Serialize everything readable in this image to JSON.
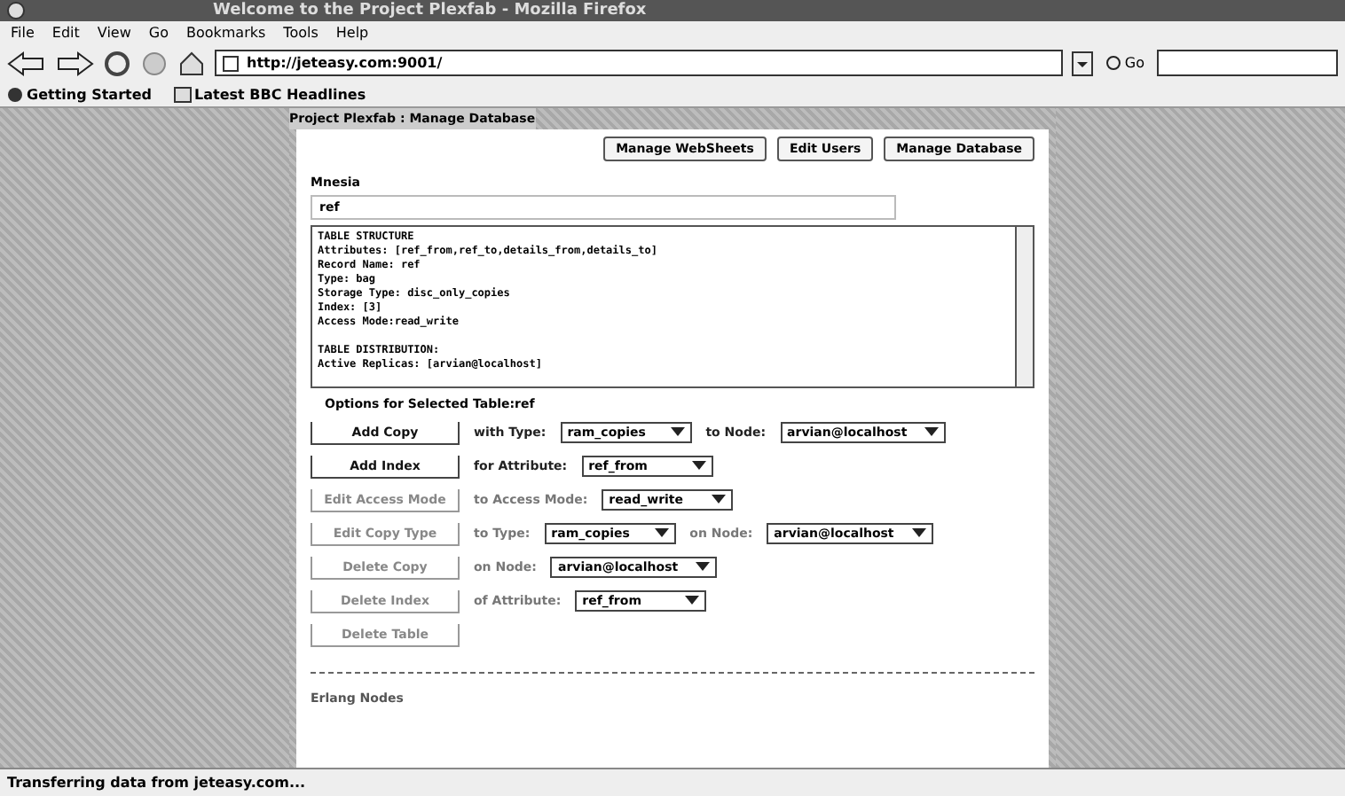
{
  "window": {
    "title": "Welcome to the Project Plexfab - Mozilla Firefox"
  },
  "menu": [
    "File",
    "Edit",
    "View",
    "Go",
    "Bookmarks",
    "Tools",
    "Help"
  ],
  "address": {
    "value": "http://jeteasy.com:9001/"
  },
  "go_label": "Go",
  "bookmarks": [
    {
      "label": "Getting Started"
    },
    {
      "label": "Latest BBC Headlines"
    }
  ],
  "breadcrumb": "Project Plexfab : Manage Database",
  "top_buttons": [
    "Manage WebSheets",
    "Edit Users",
    "Manage Database"
  ],
  "section_title": "Mnesia",
  "table_select": {
    "value": "ref"
  },
  "structure_lines": [
    "TABLE STRUCTURE",
    "Attributes: [ref_from,ref_to,details_from,details_to]",
    "Record Name: ref",
    "Type: bag",
    "Storage Type: disc_only_copies",
    "Index: [3]",
    "Access Mode:read_write"
  ],
  "distribution_lines": [
    "TABLE DISTRIBUTION:",
    "Active Replicas: [arvian@localhost]"
  ],
  "options_title": "Options for Selected Table:ref",
  "actions": [
    {
      "button": "Add Copy",
      "disabled": false,
      "parts": [
        {
          "kind": "label",
          "text": "with Type:"
        },
        {
          "kind": "select",
          "value": "ram_copies"
        },
        {
          "kind": "label",
          "text": "to Node:"
        },
        {
          "kind": "select",
          "value": "arvian@localhost"
        }
      ]
    },
    {
      "button": "Add Index",
      "disabled": false,
      "parts": [
        {
          "kind": "label",
          "text": "for Attribute:"
        },
        {
          "kind": "select",
          "value": "ref_from"
        }
      ]
    },
    {
      "button": "Edit Access Mode",
      "disabled": true,
      "parts": [
        {
          "kind": "label",
          "text": "to Access Mode:"
        },
        {
          "kind": "select",
          "value": "read_write"
        }
      ]
    },
    {
      "button": "Edit Copy Type",
      "disabled": true,
      "parts": [
        {
          "kind": "label",
          "text": "to Type:"
        },
        {
          "kind": "select",
          "value": "ram_copies"
        },
        {
          "kind": "label",
          "text": "on Node:"
        },
        {
          "kind": "select",
          "value": "arvian@localhost"
        }
      ]
    },
    {
      "button": "Delete Copy",
      "disabled": true,
      "parts": [
        {
          "kind": "label",
          "text": "on Node:"
        },
        {
          "kind": "select",
          "value": "arvian@localhost"
        }
      ]
    },
    {
      "button": "Delete Index",
      "disabled": true,
      "parts": [
        {
          "kind": "label",
          "text": "of Attribute:"
        },
        {
          "kind": "select",
          "value": "ref_from"
        }
      ]
    },
    {
      "button": "Delete Table",
      "disabled": true
    }
  ],
  "nodes_title": "Erlang Nodes",
  "status_bar": "Transferring data from jeteasy.com..."
}
